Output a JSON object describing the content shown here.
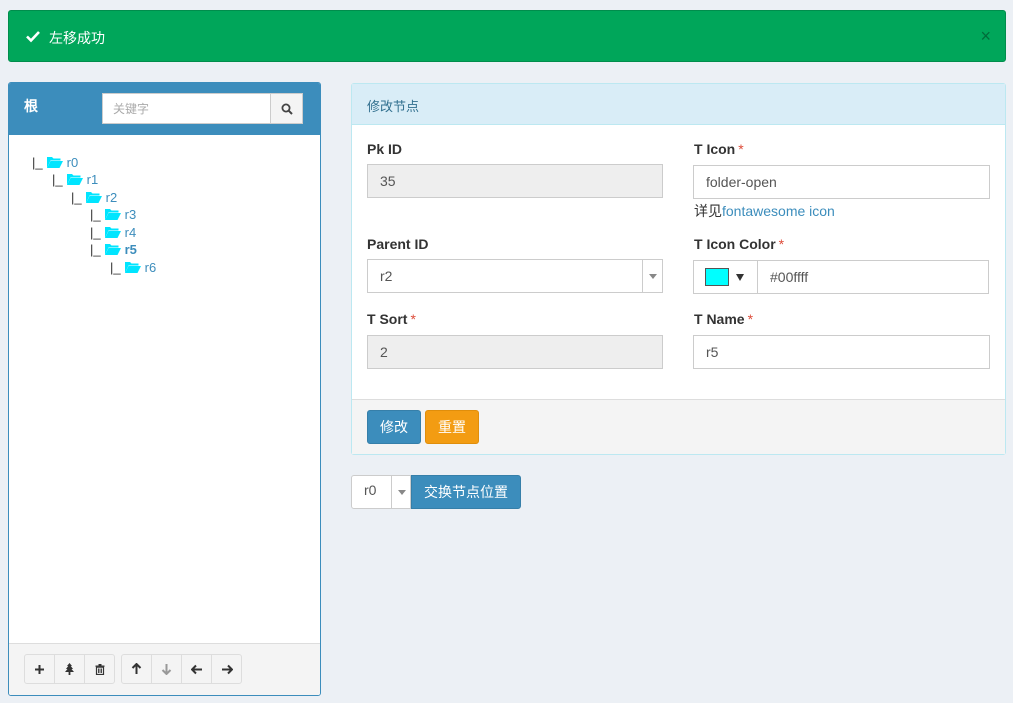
{
  "alert": {
    "icon": "check-icon",
    "message": "左移成功",
    "close": "×"
  },
  "tree_panel": {
    "root_label": "根",
    "search": {
      "placeholder": "关键字",
      "value": ""
    },
    "nodes": [
      {
        "prefix": "|_",
        "label": "r0",
        "depth": 0,
        "active": false
      },
      {
        "prefix": "|_",
        "label": "r1",
        "depth": 1,
        "active": false
      },
      {
        "prefix": "|_",
        "label": "r2",
        "depth": 2,
        "active": false
      },
      {
        "prefix": "|_",
        "label": "r3",
        "depth": 3,
        "active": false
      },
      {
        "prefix": "|_",
        "label": "r4",
        "depth": 3,
        "active": false
      },
      {
        "prefix": "|_",
        "label": "r5",
        "depth": 3,
        "active": true
      },
      {
        "prefix": "|_",
        "label": "r6",
        "depth": 4,
        "active": false
      }
    ],
    "toolbar": [
      {
        "icon": "plus-icon",
        "name": "add-node-button"
      },
      {
        "icon": "tree-icon",
        "name": "add-root-button"
      },
      {
        "icon": "trash-icon",
        "name": "delete-node-button"
      },
      {
        "icon": "arrow-up-icon",
        "name": "move-up-button"
      },
      {
        "icon": "arrow-down-icon",
        "name": "move-down-button"
      },
      {
        "icon": "arrow-left-icon",
        "name": "move-left-button"
      },
      {
        "icon": "arrow-right-icon",
        "name": "move-right-button"
      }
    ]
  },
  "form": {
    "title": "修改节点",
    "pk_id": {
      "label": "Pk ID",
      "value": "35"
    },
    "t_icon": {
      "label": "T Icon",
      "required": "*",
      "value": "folder-open",
      "help_prefix": "详见",
      "help_link": "fontawesome icon"
    },
    "parent_id": {
      "label": "Parent ID",
      "value": "r2"
    },
    "t_icon_color": {
      "label": "T Icon Color",
      "required": "*",
      "value": "#00ffff",
      "swatch_color": "#00ffff"
    },
    "t_sort": {
      "label": "T Sort",
      "required": "*",
      "value": "2"
    },
    "t_name": {
      "label": "T Name",
      "required": "*",
      "value": "r5"
    },
    "submit_label": "修改",
    "reset_label": "重置"
  },
  "swap": {
    "select_value": "r0",
    "button_label": "交换节点位置"
  },
  "colors": {
    "success": "#00a65a",
    "primary": "#3c8dbc",
    "warning": "#f39c12",
    "folder": "#00e5ff"
  }
}
